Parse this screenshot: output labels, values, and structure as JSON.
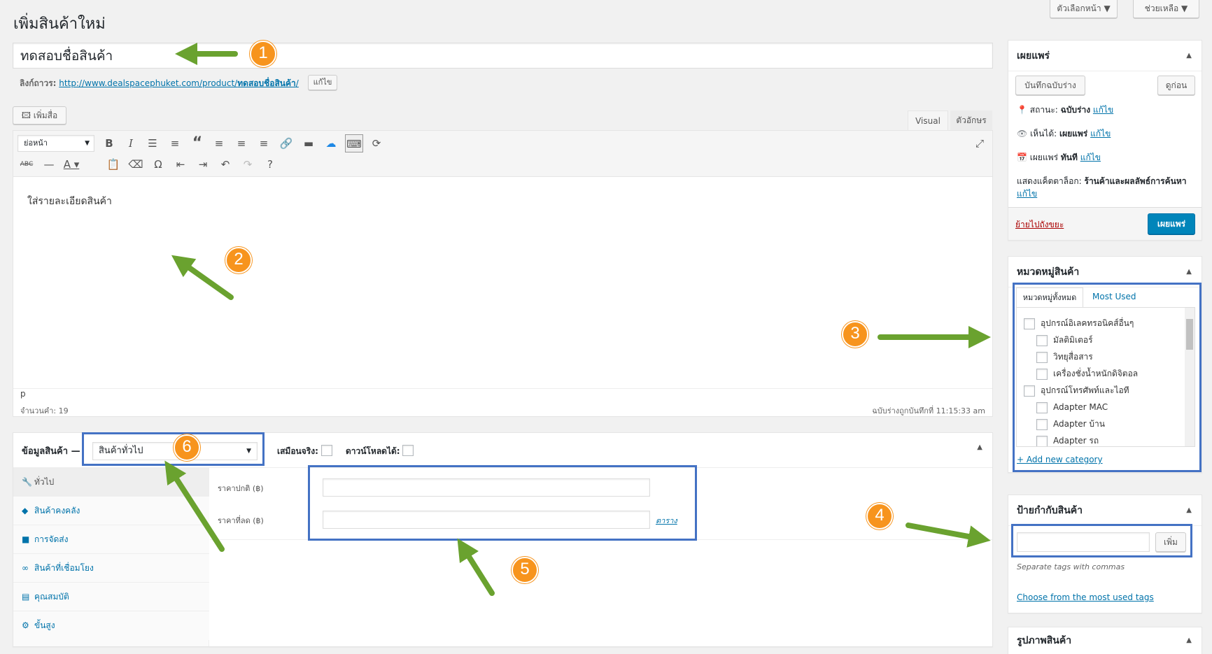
{
  "screen_options": {
    "screen_label": "ตัวเลือกหน้า ▼",
    "help_label": "ช่วยเหลือ ▼"
  },
  "page_title": "เพิ่มสินค้าใหม่",
  "title_field": {
    "value": "ทดสอบชื่อสินค้า"
  },
  "permalink": {
    "label": "ลิงก์ถาวร:",
    "url_prefix": "http://www.dealspacephuket.com/product/",
    "slug": "ทดสอบชื่อสินค้า",
    "url_suffix": "/",
    "edit_button": "แก้ไข"
  },
  "add_media": "เพิ่มสื่อ",
  "editor_tabs": {
    "visual": "Visual",
    "text": "ตัวอักษร"
  },
  "format_select": "ย่อหน้า",
  "editor_content": "ใส่รายละเอียดสินค้า",
  "status_bar": {
    "path": "p",
    "word_count": "จำนวนคำ: 19",
    "draft_saved": "ฉบับร่างถูกบันทึกที่ 11:15:33 am"
  },
  "product_data": {
    "title": "ข้อมูลสินค้า —",
    "type_select": "สินค้าทั่วไป",
    "virtual_label": "เสมือนจริง:",
    "download_label": "ดาวน์โหลดได้:",
    "tabs": [
      {
        "label": "ทั่วไป",
        "icon": "wrench-icon"
      },
      {
        "label": "สินค้าคงคลัง",
        "icon": "tag-icon"
      },
      {
        "label": "การจัดส่ง",
        "icon": "truck-icon"
      },
      {
        "label": "สินค้าที่เชื่อมโยง",
        "icon": "link-icon"
      },
      {
        "label": "คุณสมบัติ",
        "icon": "list-icon"
      },
      {
        "label": "ขั้นสูง",
        "icon": "gear-icon"
      }
    ],
    "regular_price_label": "ราคาปกติ (฿)",
    "sale_price_label": "ราคาที่ลด (฿)",
    "schedule_link": "ตาราง"
  },
  "publish_box": {
    "title": "เผยแพร่",
    "save_draft": "บันทึกฉบับร่าง",
    "preview": "ดูก่อน",
    "status_label": "สถานะ:",
    "status_value": "ฉบับร่าง",
    "visibility_label": "เห็นได้:",
    "visibility_value": "เผยแพร่",
    "publish_label": "เผยแพร่",
    "publish_value": "ทันที",
    "edit": "แก้ไข",
    "catalog_label": "แสดงแค็ตตาล็อก:",
    "catalog_value": "ร้านค้าและผลลัพธ์การค้นหา",
    "trash": "ย้ายไปถังขยะ",
    "publish_button": "เผยแพร่"
  },
  "categories_box": {
    "title": "หมวดหมู่สินค้า",
    "tab_all": "หมวดหมู่ทั้งหมด",
    "tab_most_used": "Most Used",
    "items": [
      {
        "label": "อุปกรณ์อิเลคทรอนิคส์อื่นๆ",
        "level": 0
      },
      {
        "label": "มัลติมิเตอร์",
        "level": 1
      },
      {
        "label": "วิทยุสื่อสาร",
        "level": 1
      },
      {
        "label": "เครื่องชั่งน้ำหนักดิจิตอล",
        "level": 1
      },
      {
        "label": "อุปกรณ์โทรศัพท์และไอที",
        "level": 0
      },
      {
        "label": "Adapter MAC",
        "level": 1
      },
      {
        "label": "Adapter บ้าน",
        "level": 1
      },
      {
        "label": "Adapter รถ",
        "level": 1
      }
    ],
    "add_new": "+ Add new category"
  },
  "tags_box": {
    "title": "ป้ายกำกับสินค้า",
    "add_button": "เพิ่ม",
    "hint": "Separate tags with commas",
    "choose_link": "Choose from the most used tags"
  },
  "image_box": {
    "title": "รูปภาพสินค้า"
  },
  "annotations": [
    "1",
    "2",
    "3",
    "4",
    "5",
    "6"
  ],
  "colors": {
    "accent": "#0085ba",
    "arrow": "#6aa22f",
    "badge": "#f7941d",
    "highlight": "#4472c4"
  }
}
